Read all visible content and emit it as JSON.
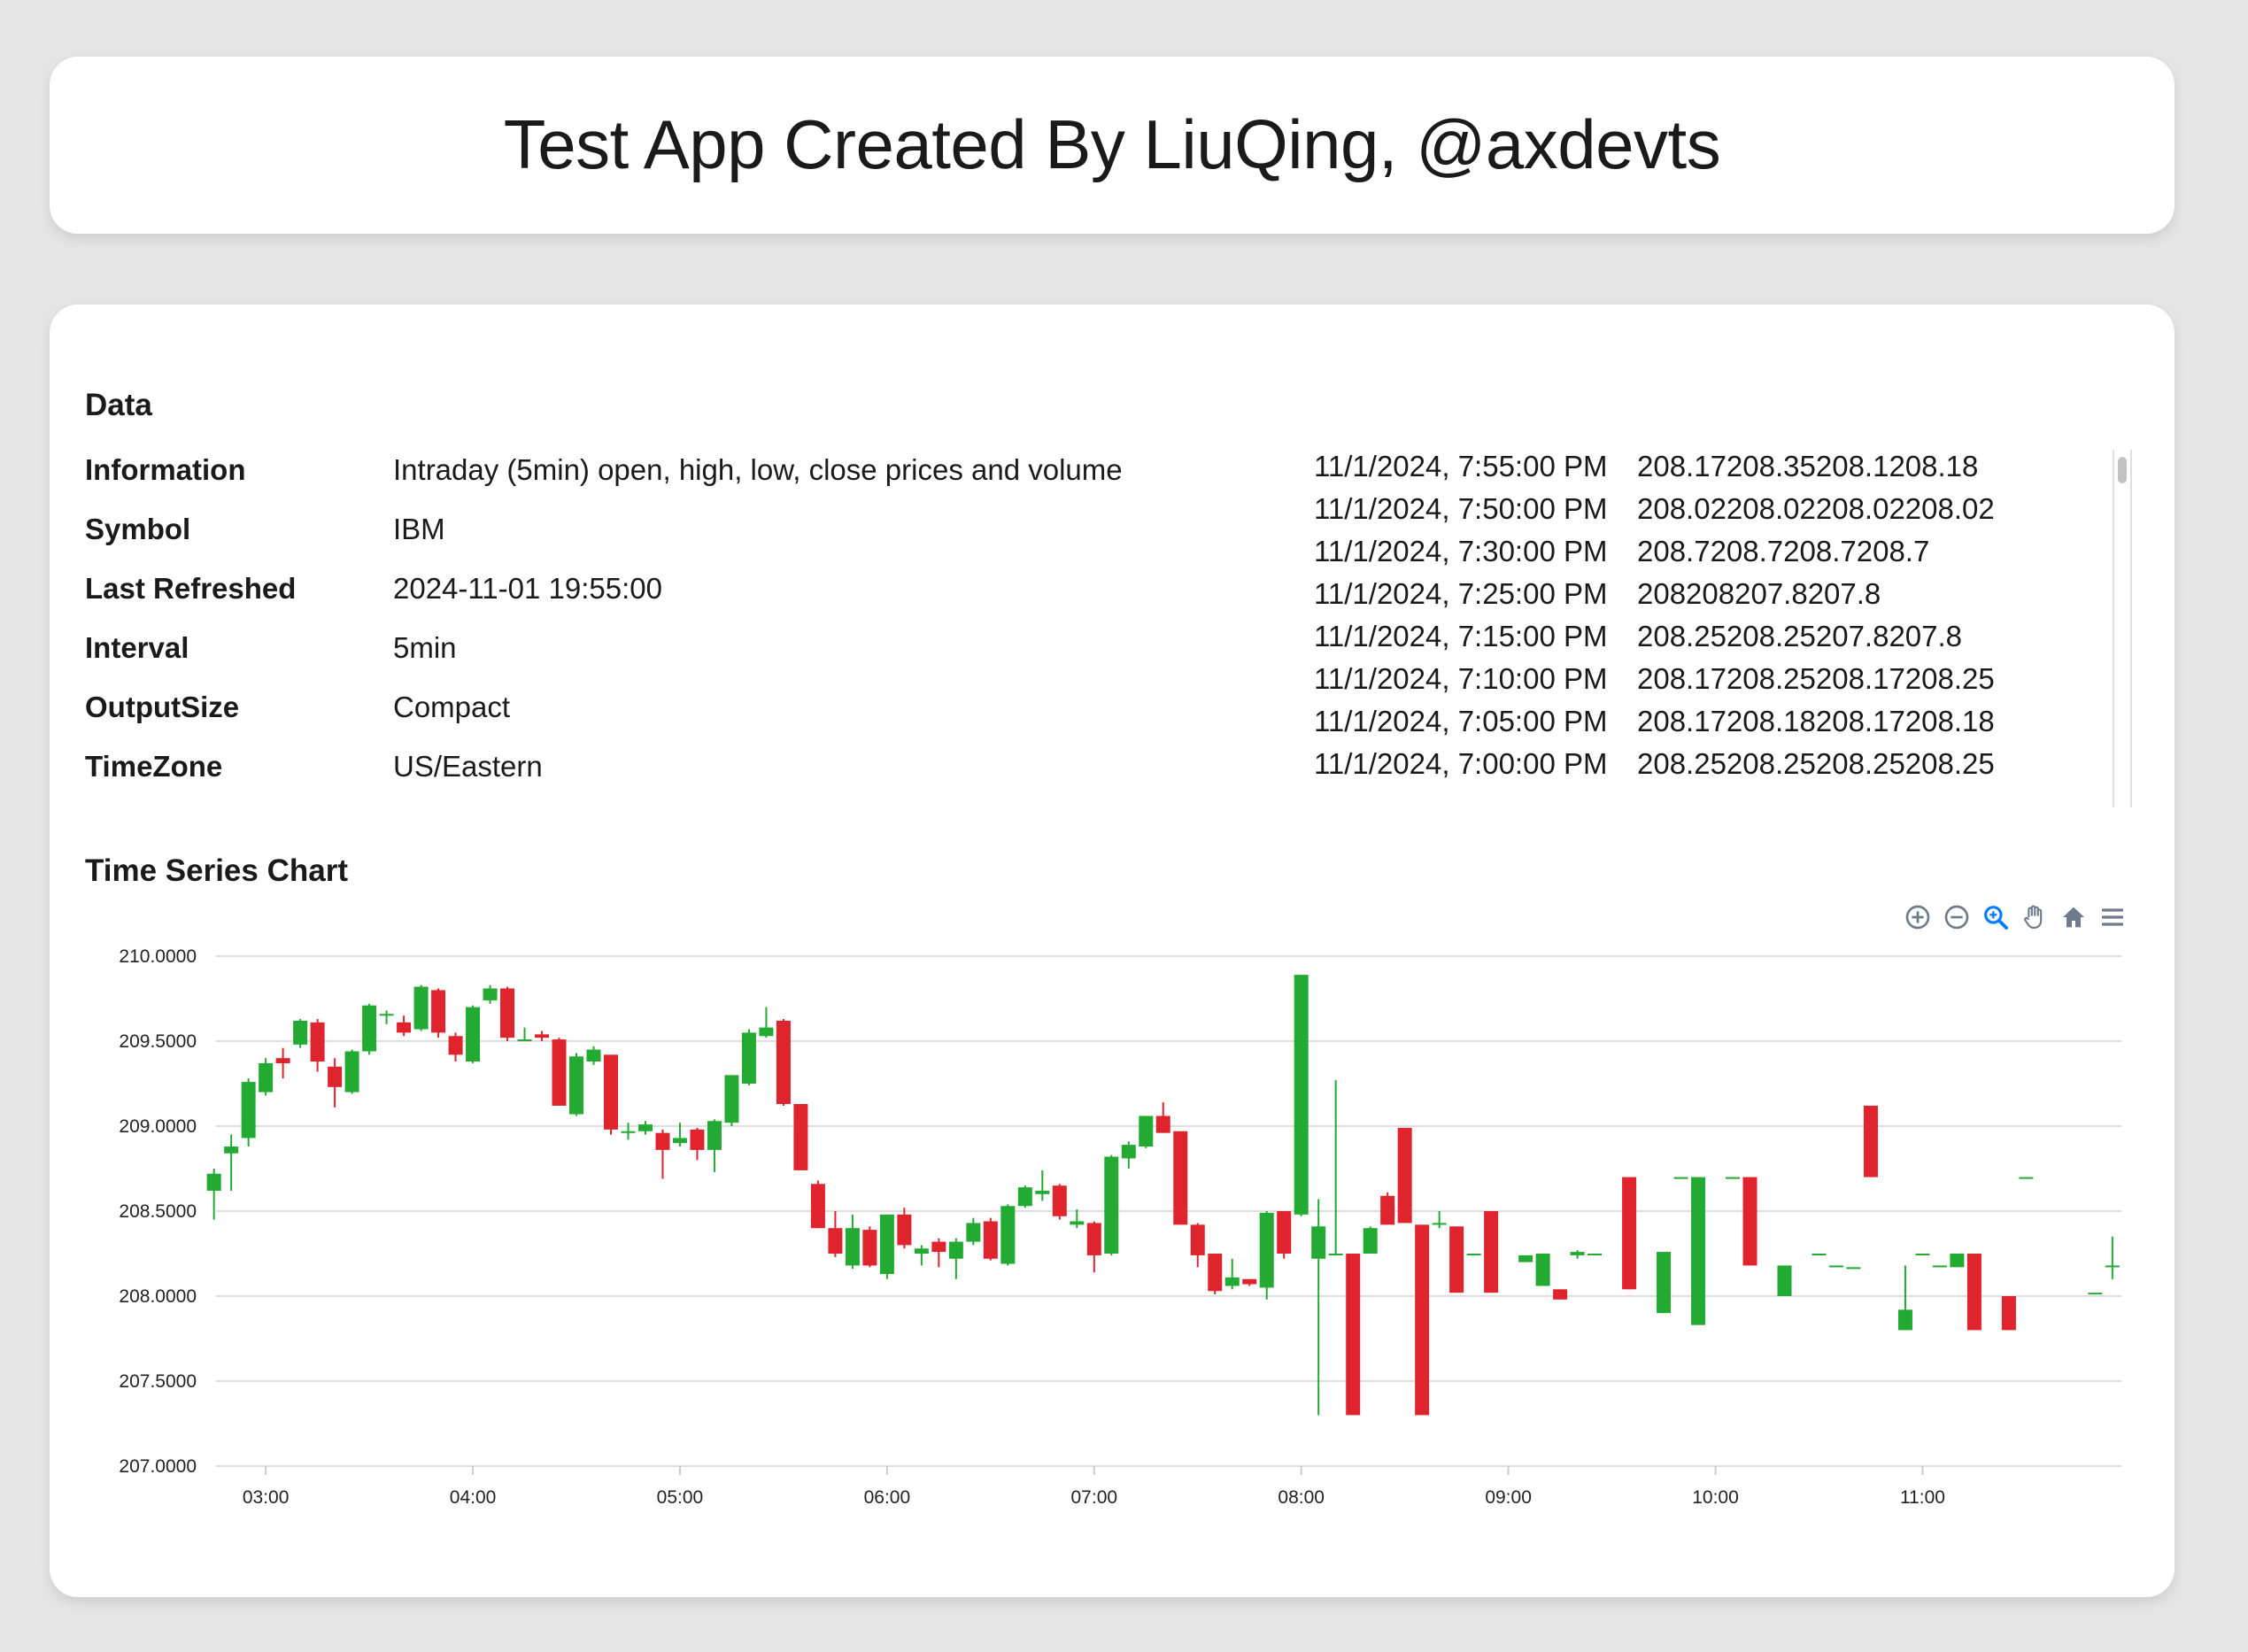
{
  "app": {
    "title": "Test App Created By LiuQing, @axdevts"
  },
  "data_section": {
    "title": "Data",
    "meta": [
      {
        "key": "Information",
        "value": "Intraday (5min) open, high, low, close prices and volume"
      },
      {
        "key": "Symbol",
        "value": "IBM"
      },
      {
        "key": "Last Refreshed",
        "value": "2024-11-01 19:55:00"
      },
      {
        "key": "Interval",
        "value": "5min"
      },
      {
        "key": "OutputSize",
        "value": "Compact"
      },
      {
        "key": "TimeZone",
        "value": "US/Eastern"
      }
    ],
    "series_rows": [
      {
        "time": "11/1/2024, 7:55:00 PM",
        "values": "208.17208.35208.1208.18"
      },
      {
        "time": "11/1/2024, 7:50:00 PM",
        "values": "208.02208.02208.02208.02"
      },
      {
        "time": "11/1/2024, 7:30:00 PM",
        "values": "208.7208.7208.7208.7"
      },
      {
        "time": "11/1/2024, 7:25:00 PM",
        "values": "208208207.8207.8"
      },
      {
        "time": "11/1/2024, 7:15:00 PM",
        "values": "208.25208.25207.8207.8"
      },
      {
        "time": "11/1/2024, 7:10:00 PM",
        "values": "208.17208.25208.17208.25"
      },
      {
        "time": "11/1/2024, 7:05:00 PM",
        "values": "208.17208.18208.17208.18"
      },
      {
        "time": "11/1/2024, 7:00:00 PM",
        "values": "208.25208.25208.25208.25"
      }
    ]
  },
  "chart_section": {
    "title": "Time Series Chart",
    "toolbar": [
      {
        "name": "zoom-in-icon"
      },
      {
        "name": "zoom-out-icon"
      },
      {
        "name": "magnifier-icon"
      },
      {
        "name": "pan-hand-icon"
      },
      {
        "name": "home-icon"
      },
      {
        "name": "menu-icon"
      }
    ]
  },
  "chart_data": {
    "type": "candlestick",
    "colors": {
      "up": "#22aa33",
      "down": "#e0242e",
      "grid": "#dddddd",
      "toolbar": "#6e7b8b",
      "toolbar_active": "#0a7cff"
    },
    "ylim": [
      207.0,
      210.0
    ],
    "yticks": [
      "210.0000",
      "209.5000",
      "209.0000",
      "208.5000",
      "208.0000",
      "207.5000",
      "207.0000"
    ],
    "xlim_hours": [
      2.76,
      11.96
    ],
    "xticks": [
      {
        "label": "03:00",
        "h": 3
      },
      {
        "label": "04:00",
        "h": 4
      },
      {
        "label": "05:00",
        "h": 5
      },
      {
        "label": "06:00",
        "h": 6
      },
      {
        "label": "07:00",
        "h": 7
      },
      {
        "label": "08:00",
        "h": 8
      },
      {
        "label": "09:00",
        "h": 9
      },
      {
        "label": "10:00",
        "h": 10
      },
      {
        "label": "11:00",
        "h": 11
      }
    ],
    "candles": [
      {
        "t": "02:45",
        "o": 208.62,
        "h": 208.75,
        "l": 208.45,
        "c": 208.72
      },
      {
        "t": "02:50",
        "o": 208.84,
        "h": 208.95,
        "l": 208.62,
        "c": 208.88
      },
      {
        "t": "02:55",
        "o": 208.93,
        "h": 209.28,
        "l": 208.88,
        "c": 209.26
      },
      {
        "t": "03:00",
        "o": 209.2,
        "h": 209.4,
        "l": 209.18,
        "c": 209.37
      },
      {
        "t": "03:05",
        "o": 209.4,
        "h": 209.46,
        "l": 209.28,
        "c": 209.37
      },
      {
        "t": "03:10",
        "o": 209.48,
        "h": 209.63,
        "l": 209.46,
        "c": 209.62
      },
      {
        "t": "03:15",
        "o": 209.61,
        "h": 209.63,
        "l": 209.32,
        "c": 209.38
      },
      {
        "t": "03:20",
        "o": 209.35,
        "h": 209.4,
        "l": 209.11,
        "c": 209.23
      },
      {
        "t": "03:25",
        "o": 209.2,
        "h": 209.45,
        "l": 209.19,
        "c": 209.44
      },
      {
        "t": "03:30",
        "o": 209.44,
        "h": 209.72,
        "l": 209.42,
        "c": 209.71
      },
      {
        "t": "03:35",
        "o": 209.66,
        "h": 209.68,
        "l": 209.6,
        "c": 209.66
      },
      {
        "t": "03:40",
        "o": 209.61,
        "h": 209.65,
        "l": 209.53,
        "c": 209.55
      },
      {
        "t": "03:45",
        "o": 209.57,
        "h": 209.83,
        "l": 209.56,
        "c": 209.82
      },
      {
        "t": "03:50",
        "o": 209.8,
        "h": 209.81,
        "l": 209.52,
        "c": 209.55
      },
      {
        "t": "03:55",
        "o": 209.53,
        "h": 209.55,
        "l": 209.38,
        "c": 209.42
      },
      {
        "t": "04:00",
        "o": 209.38,
        "h": 209.71,
        "l": 209.37,
        "c": 209.7
      },
      {
        "t": "04:05",
        "o": 209.74,
        "h": 209.83,
        "l": 209.72,
        "c": 209.81
      },
      {
        "t": "04:10",
        "o": 209.81,
        "h": 209.82,
        "l": 209.5,
        "c": 209.52
      },
      {
        "t": "04:15",
        "o": 209.51,
        "h": 209.58,
        "l": 209.5,
        "c": 209.51
      },
      {
        "t": "04:20",
        "o": 209.54,
        "h": 209.56,
        "l": 209.5,
        "c": 209.52
      },
      {
        "t": "04:25",
        "o": 209.51,
        "h": 209.52,
        "l": 209.12,
        "c": 209.12
      },
      {
        "t": "04:30",
        "o": 209.07,
        "h": 209.43,
        "l": 209.06,
        "c": 209.41
      },
      {
        "t": "04:35",
        "o": 209.38,
        "h": 209.47,
        "l": 209.36,
        "c": 209.45
      },
      {
        "t": "04:40",
        "o": 209.42,
        "h": 209.42,
        "l": 208.95,
        "c": 208.98
      },
      {
        "t": "04:45",
        "o": 208.96,
        "h": 209.02,
        "l": 208.92,
        "c": 208.97
      },
      {
        "t": "04:50",
        "o": 208.97,
        "h": 209.03,
        "l": 208.95,
        "c": 209.01
      },
      {
        "t": "04:55",
        "o": 208.96,
        "h": 208.98,
        "l": 208.69,
        "c": 208.86
      },
      {
        "t": "05:00",
        "o": 208.9,
        "h": 209.02,
        "l": 208.88,
        "c": 208.93
      },
      {
        "t": "05:05",
        "o": 208.98,
        "h": 208.99,
        "l": 208.8,
        "c": 208.86
      },
      {
        "t": "05:10",
        "o": 208.86,
        "h": 209.04,
        "l": 208.73,
        "c": 209.03
      },
      {
        "t": "05:15",
        "o": 209.02,
        "h": 209.3,
        "l": 209.0,
        "c": 209.3
      },
      {
        "t": "05:20",
        "o": 209.25,
        "h": 209.57,
        "l": 209.24,
        "c": 209.55
      },
      {
        "t": "05:25",
        "o": 209.53,
        "h": 209.7,
        "l": 209.52,
        "c": 209.58
      },
      {
        "t": "05:30",
        "o": 209.62,
        "h": 209.63,
        "l": 209.12,
        "c": 209.13
      },
      {
        "t": "05:35",
        "o": 209.13,
        "h": 209.13,
        "l": 208.74,
        "c": 208.74
      },
      {
        "t": "05:40",
        "o": 208.66,
        "h": 208.68,
        "l": 208.4,
        "c": 208.4
      },
      {
        "t": "05:45",
        "o": 208.4,
        "h": 208.5,
        "l": 208.23,
        "c": 208.25
      },
      {
        "t": "05:50",
        "o": 208.18,
        "h": 208.48,
        "l": 208.16,
        "c": 208.4
      },
      {
        "t": "05:55",
        "o": 208.39,
        "h": 208.41,
        "l": 208.17,
        "c": 208.18
      },
      {
        "t": "06:00",
        "o": 208.13,
        "h": 208.48,
        "l": 208.1,
        "c": 208.48
      },
      {
        "t": "06:05",
        "o": 208.48,
        "h": 208.52,
        "l": 208.28,
        "c": 208.3
      },
      {
        "t": "06:10",
        "o": 208.25,
        "h": 208.3,
        "l": 208.18,
        "c": 208.28
      },
      {
        "t": "06:15",
        "o": 208.32,
        "h": 208.34,
        "l": 208.17,
        "c": 208.26
      },
      {
        "t": "06:20",
        "o": 208.22,
        "h": 208.34,
        "l": 208.1,
        "c": 208.32
      },
      {
        "t": "06:25",
        "o": 208.32,
        "h": 208.46,
        "l": 208.3,
        "c": 208.43
      },
      {
        "t": "06:30",
        "o": 208.44,
        "h": 208.46,
        "l": 208.21,
        "c": 208.22
      },
      {
        "t": "06:35",
        "o": 208.19,
        "h": 208.54,
        "l": 208.18,
        "c": 208.53
      },
      {
        "t": "06:40",
        "o": 208.53,
        "h": 208.65,
        "l": 208.52,
        "c": 208.64
      },
      {
        "t": "06:45",
        "o": 208.6,
        "h": 208.74,
        "l": 208.56,
        "c": 208.62
      },
      {
        "t": "06:50",
        "o": 208.65,
        "h": 208.66,
        "l": 208.45,
        "c": 208.47
      },
      {
        "t": "06:55",
        "o": 208.42,
        "h": 208.51,
        "l": 208.4,
        "c": 208.44
      },
      {
        "t": "07:00",
        "o": 208.43,
        "h": 208.44,
        "l": 208.14,
        "c": 208.24
      },
      {
        "t": "07:05",
        "o": 208.25,
        "h": 208.83,
        "l": 208.24,
        "c": 208.82
      },
      {
        "t": "07:10",
        "o": 208.81,
        "h": 208.91,
        "l": 208.75,
        "c": 208.89
      },
      {
        "t": "07:15",
        "o": 208.88,
        "h": 209.06,
        "l": 208.87,
        "c": 209.06
      },
      {
        "t": "07:20",
        "o": 209.06,
        "h": 209.14,
        "l": 208.96,
        "c": 208.96
      },
      {
        "t": "07:25",
        "o": 208.97,
        "h": 208.97,
        "l": 208.42,
        "c": 208.42
      },
      {
        "t": "07:30",
        "o": 208.42,
        "h": 208.43,
        "l": 208.17,
        "c": 208.24
      },
      {
        "t": "07:35",
        "o": 208.25,
        "h": 208.25,
        "l": 208.01,
        "c": 208.03
      },
      {
        "t": "07:40",
        "o": 208.06,
        "h": 208.22,
        "l": 208.04,
        "c": 208.11
      },
      {
        "t": "07:45",
        "o": 208.1,
        "h": 208.1,
        "l": 208.06,
        "c": 208.07
      },
      {
        "t": "07:50",
        "o": 208.05,
        "h": 208.5,
        "l": 207.98,
        "c": 208.49
      },
      {
        "t": "07:55",
        "o": 208.5,
        "h": 208.5,
        "l": 208.22,
        "c": 208.25
      },
      {
        "t": "08:00",
        "o": 208.48,
        "h": 209.89,
        "l": 208.47,
        "c": 209.89
      },
      {
        "t": "08:05",
        "o": 208.22,
        "h": 208.57,
        "l": 207.3,
        "c": 208.41
      },
      {
        "t": "08:10",
        "o": 208.25,
        "h": 209.27,
        "l": 208.25,
        "c": 208.25
      },
      {
        "t": "08:15",
        "o": 208.25,
        "h": 208.25,
        "l": 207.3,
        "c": 207.3
      },
      {
        "t": "08:20",
        "o": 208.25,
        "h": 208.41,
        "l": 208.25,
        "c": 208.4
      },
      {
        "t": "08:25",
        "o": 208.59,
        "h": 208.61,
        "l": 208.42,
        "c": 208.42
      },
      {
        "t": "08:30",
        "o": 208.99,
        "h": 208.99,
        "l": 208.43,
        "c": 208.43
      },
      {
        "t": "08:35",
        "o": 208.42,
        "h": 208.42,
        "l": 207.3,
        "c": 207.3
      },
      {
        "t": "08:40",
        "o": 208.43,
        "h": 208.5,
        "l": 208.4,
        "c": 208.43
      },
      {
        "t": "08:45",
        "o": 208.41,
        "h": 208.41,
        "l": 208.02,
        "c": 208.02
      },
      {
        "t": "08:50",
        "o": 208.25,
        "h": 208.25,
        "l": 208.24,
        "c": 208.25
      },
      {
        "t": "08:55",
        "o": 208.5,
        "h": 208.5,
        "l": 208.02,
        "c": 208.02
      },
      {
        "t": "09:05",
        "o": 208.2,
        "h": 208.24,
        "l": 208.2,
        "c": 208.24
      },
      {
        "t": "09:10",
        "o": 208.06,
        "h": 208.25,
        "l": 208.06,
        "c": 208.25
      },
      {
        "t": "09:15",
        "o": 208.04,
        "h": 208.04,
        "l": 207.98,
        "c": 207.98
      },
      {
        "t": "09:20",
        "o": 208.24,
        "h": 208.27,
        "l": 208.22,
        "c": 208.26
      },
      {
        "t": "09:25",
        "o": 208.25,
        "h": 208.25,
        "l": 208.25,
        "c": 208.25
      },
      {
        "t": "09:35",
        "o": 208.7,
        "h": 208.7,
        "l": 208.04,
        "c": 208.04
      },
      {
        "t": "09:45",
        "o": 207.9,
        "h": 208.26,
        "l": 207.9,
        "c": 208.26
      },
      {
        "t": "09:50",
        "o": 208.7,
        "h": 208.7,
        "l": 208.7,
        "c": 208.7
      },
      {
        "t": "09:55",
        "o": 207.83,
        "h": 208.7,
        "l": 207.83,
        "c": 208.7
      },
      {
        "t": "10:05",
        "o": 208.7,
        "h": 208.7,
        "l": 208.7,
        "c": 208.7
      },
      {
        "t": "10:10",
        "o": 208.7,
        "h": 208.7,
        "l": 208.18,
        "c": 208.18
      },
      {
        "t": "10:20",
        "o": 208.0,
        "h": 208.18,
        "l": 208.0,
        "c": 208.18
      },
      {
        "t": "10:30",
        "o": 208.25,
        "h": 208.25,
        "l": 208.25,
        "c": 208.25
      },
      {
        "t": "10:35",
        "o": 208.17,
        "h": 208.18,
        "l": 208.17,
        "c": 208.18
      },
      {
        "t": "10:40",
        "o": 208.17,
        "h": 208.17,
        "l": 208.17,
        "c": 208.17
      },
      {
        "t": "10:45",
        "o": 209.12,
        "h": 209.12,
        "l": 208.7,
        "c": 208.7
      },
      {
        "t": "10:55",
        "o": 207.8,
        "h": 208.18,
        "l": 207.8,
        "c": 207.92
      },
      {
        "t": "11:00",
        "o": 208.25,
        "h": 208.25,
        "l": 208.25,
        "c": 208.25
      },
      {
        "t": "11:05",
        "o": 208.17,
        "h": 208.18,
        "l": 208.17,
        "c": 208.18
      },
      {
        "t": "11:10",
        "o": 208.17,
        "h": 208.25,
        "l": 208.17,
        "c": 208.25
      },
      {
        "t": "11:15",
        "o": 208.25,
        "h": 208.25,
        "l": 207.8,
        "c": 207.8
      },
      {
        "t": "11:25",
        "o": 208.0,
        "h": 208.0,
        "l": 207.8,
        "c": 207.8
      },
      {
        "t": "11:30",
        "o": 208.7,
        "h": 208.7,
        "l": 208.7,
        "c": 208.7
      },
      {
        "t": "11:50",
        "o": 208.02,
        "h": 208.02,
        "l": 208.02,
        "c": 208.02
      },
      {
        "t": "11:55",
        "o": 208.17,
        "h": 208.35,
        "l": 208.1,
        "c": 208.18
      }
    ]
  }
}
